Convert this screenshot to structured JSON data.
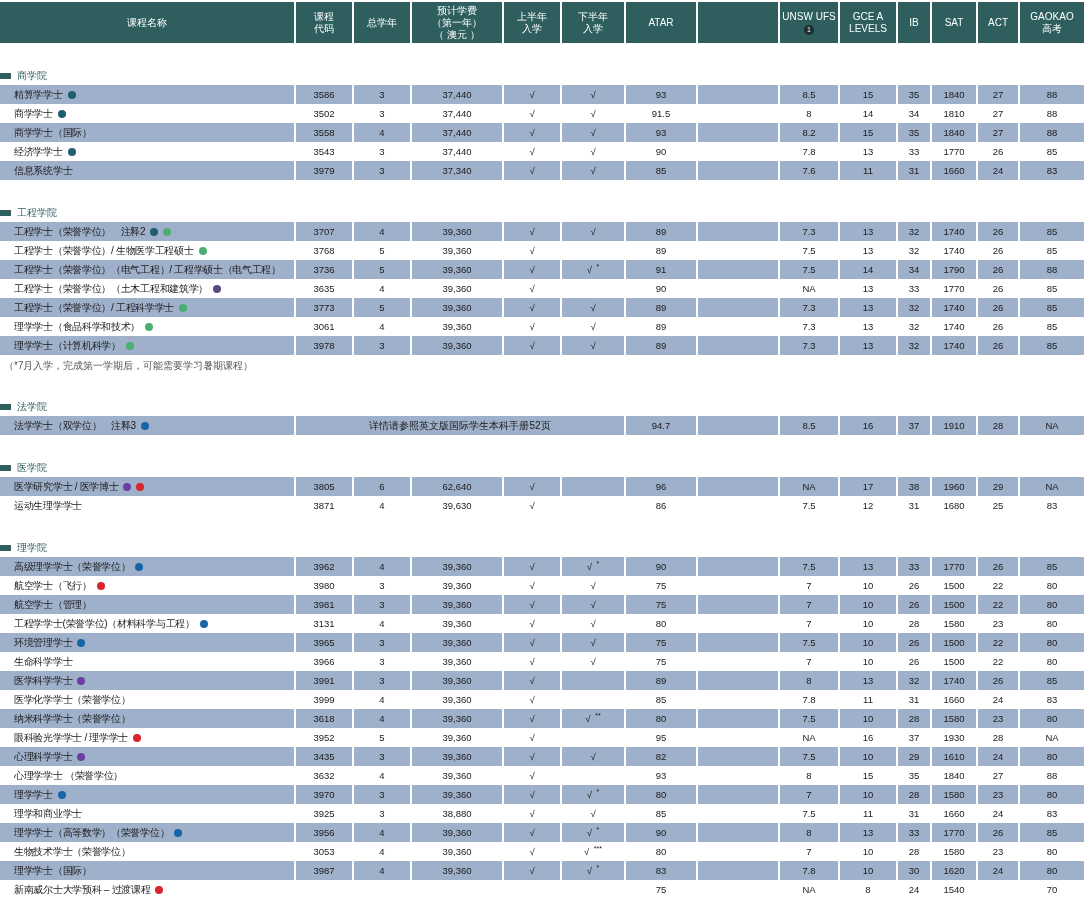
{
  "header": [
    {
      "lines": [
        "课程名称"
      ]
    },
    {
      "lines": [
        "课程",
        "代码"
      ]
    },
    {
      "lines": [
        "总学年"
      ]
    },
    {
      "lines": [
        "预计学费",
        "（第一年）",
        "（ 澳元 ）"
      ]
    },
    {
      "lines": [
        "上半年",
        "入学"
      ]
    },
    {
      "lines": [
        "下半年",
        "入学"
      ]
    },
    {
      "lines": [
        "ATAR"
      ]
    },
    {
      "lines": [
        "UNSW UFS"
      ],
      "badge": "1"
    },
    {
      "lines": [
        "GCE A",
        "LEVELS"
      ]
    },
    {
      "lines": [
        "IB"
      ]
    },
    {
      "lines": [
        "SAT"
      ]
    },
    {
      "lines": [
        "ACT"
      ]
    },
    {
      "lines": [
        "GAOKAO",
        "高考"
      ]
    }
  ],
  "sections": [
    {
      "title": "商学院",
      "rows": [
        {
          "name": "精算学学士",
          "dots": [
            {
              "color": "#1d5f72"
            }
          ],
          "code": "3586",
          "years": "3",
          "fee": "37,440",
          "first_half": "√",
          "second_half": "√",
          "atar": "93",
          "ufs": "8.5",
          "gce": "15",
          "ib": "35",
          "sat": "1840",
          "act": "27",
          "gaokao": "88"
        },
        {
          "name": "商学学士",
          "dots": [
            {
              "color": "#1d5f72"
            }
          ],
          "code": "3502",
          "years": "3",
          "fee": "37,440",
          "first_half": "√",
          "second_half": "√",
          "atar": "91.5",
          "ufs": "8",
          "gce": "14",
          "ib": "34",
          "sat": "1810",
          "act": "27",
          "gaokao": "88"
        },
        {
          "name": "商学学士（国际）",
          "code": "3558",
          "years": "4",
          "fee": "37,440",
          "first_half": "√",
          "second_half": "√",
          "atar": "93",
          "ufs": "8.2",
          "gce": "15",
          "ib": "35",
          "sat": "1840",
          "act": "27",
          "gaokao": "88"
        },
        {
          "name": "经济学学士",
          "dots": [
            {
              "color": "#1d5f72"
            }
          ],
          "code": "3543",
          "years": "3",
          "fee": "37,440",
          "first_half": "√",
          "second_half": "√",
          "atar": "90",
          "ufs": "7.8",
          "gce": "13",
          "ib": "33",
          "sat": "1770",
          "act": "26",
          "gaokao": "85"
        },
        {
          "name": "信息系统学士",
          "code": "3979",
          "years": "3",
          "fee": "37,340",
          "first_half": "√",
          "second_half": "√",
          "atar": "85",
          "ufs": "7.6",
          "gce": "11",
          "ib": "31",
          "sat": "1660",
          "act": "24",
          "gaokao": "83"
        }
      ]
    },
    {
      "title": "工程学院",
      "rows": [
        {
          "name": "工程学士（荣誉学位）　注释2",
          "dots": [
            {
              "color": "#1d5f72"
            },
            {
              "color": "#4caf72"
            }
          ],
          "code": "3707",
          "years": "4",
          "fee": "39,360",
          "first_half": "√",
          "second_half": "√",
          "atar": "89",
          "ufs": "7.3",
          "gce": "13",
          "ib": "32",
          "sat": "1740",
          "act": "26",
          "gaokao": "85"
        },
        {
          "name": "工程学士（荣誉学位）/ 生物医学工程硕士",
          "dots": [
            {
              "color": "#4caf72"
            }
          ],
          "code": "3768",
          "years": "5",
          "fee": "39,360",
          "first_half": "√",
          "atar": "89",
          "ufs": "7.5",
          "gce": "13",
          "ib": "32",
          "sat": "1740",
          "act": "26",
          "gaokao": "85"
        },
        {
          "name": "工程学士（荣誉学位）（电气工程）/ 工程学硕士（电气工程）",
          "code": "3736",
          "years": "5",
          "fee": "39,360",
          "first_half": "√",
          "second_half": "√ $^{*}$",
          "atar": "91",
          "ufs": "7.5",
          "gce": "14",
          "ib": "34",
          "sat": "1790",
          "act": "26",
          "gaokao": "88"
        },
        {
          "name": "工程学士（荣誉学位）（土木工程和建筑学）",
          "dots": [
            {
              "color": "#5a4a7e"
            }
          ],
          "code": "3635",
          "years": "4",
          "fee": "39,360",
          "first_half": "√",
          "atar": "90",
          "ufs": "NA",
          "gce": "13",
          "ib": "33",
          "sat": "1770",
          "act": "26",
          "gaokao": "85"
        },
        {
          "name": "工程学士（荣誉学位）/ 工程科学学士",
          "dots": [
            {
              "color": "#4caf72"
            }
          ],
          "code": "3773",
          "years": "5",
          "fee": "39,360",
          "first_half": "√",
          "second_half": "√",
          "atar": "89",
          "ufs": "7.3",
          "gce": "13",
          "ib": "32",
          "sat": "1740",
          "act": "26",
          "gaokao": "85"
        },
        {
          "name": "理学学士（食品科学和技术）",
          "dots": [
            {
              "color": "#4caf72"
            }
          ],
          "code": "3061",
          "years": "4",
          "fee": "39,360",
          "first_half": "√",
          "second_half": "√",
          "atar": "89",
          "ufs": "7.3",
          "gce": "13",
          "ib": "32",
          "sat": "1740",
          "act": "26",
          "gaokao": "85"
        },
        {
          "name": "理学学士（计算机科学）",
          "dots": [
            {
              "color": "#4caf72"
            }
          ],
          "code": "3978",
          "years": "3",
          "fee": "39,360",
          "first_half": "√",
          "second_half": "√",
          "atar": "89",
          "ufs": "7.3",
          "gce": "13",
          "ib": "32",
          "sat": "1740",
          "act": "26",
          "gaokao": "85"
        }
      ],
      "note": "（*7月入学，完成第一学期后，可能需要学习暑期课程）"
    },
    {
      "title": "法学院",
      "rows": [
        {
          "name": "法学学士（双学位）　注释3",
          "dots": [
            {
              "color": "#1565a8"
            }
          ],
          "span_text": "详情请参照英文版国际学生本科手册52页",
          "atar": "94.7",
          "ufs": "8.5",
          "gce": "16",
          "ib": "37",
          "sat": "1910",
          "act": "28",
          "gaokao": "NA"
        }
      ]
    },
    {
      "title": "医学院",
      "rows": [
        {
          "name": "医学研究学士 / 医学博士",
          "dots": [
            {
              "color": "#6b3fa0"
            },
            {
              "color": "#d9262e"
            }
          ],
          "code": "3805",
          "years": "6",
          "fee": "62,640",
          "first_half": "√",
          "atar": "96",
          "ufs": "NA",
          "gce": "17",
          "ib": "38",
          "sat": "1960",
          "act": "29",
          "gaokao": "NA"
        },
        {
          "name": "运动生理学学士",
          "code": "3871",
          "years": "4",
          "fee": "39,630",
          "first_half": "√",
          "atar": "86",
          "ufs": "7.5",
          "gce": "12",
          "ib": "31",
          "sat": "1680",
          "act": "25",
          "gaokao": "83"
        }
      ]
    },
    {
      "title": "理学院",
      "rows": [
        {
          "name": "高级理学学士（荣誉学位）",
          "dots": [
            {
              "color": "#1565a8"
            }
          ],
          "code": "3962",
          "years": "4",
          "fee": "39,360",
          "first_half": "√",
          "second_half": "√ $^{*}$",
          "atar": "90",
          "ufs": "7.5",
          "gce": "13",
          "ib": "33",
          "sat": "1770",
          "act": "26",
          "gaokao": "85"
        },
        {
          "name": "航空学士（飞行）",
          "dots": [
            {
              "color": "#d9262e"
            }
          ],
          "code": "3980",
          "years": "3",
          "fee": "39,360",
          "first_half": "√",
          "second_half": "√",
          "atar": "75",
          "ufs": "7",
          "gce": "10",
          "ib": "26",
          "sat": "1500",
          "act": "22",
          "gaokao": "80"
        },
        {
          "name": "航空学士（管理）",
          "code": "3981",
          "years": "3",
          "fee": "39,360",
          "first_half": "√",
          "second_half": "√",
          "atar": "75",
          "ufs": "7",
          "gce": "10",
          "ib": "26",
          "sat": "1500",
          "act": "22",
          "gaokao": "80"
        },
        {
          "name": "工程学学士(荣誉学位)（材料科学与工程）",
          "dots": [
            {
              "color": "#1565a8"
            }
          ],
          "code": "3131",
          "years": "4",
          "fee": "39,360",
          "first_half": "√",
          "second_half": "√",
          "atar": "80",
          "ufs": "7",
          "gce": "10",
          "ib": "28",
          "sat": "1580",
          "act": "23",
          "gaokao": "80"
        },
        {
          "name": "环境管理学士",
          "dots": [
            {
              "color": "#1565a8"
            }
          ],
          "code": "3965",
          "years": "3",
          "fee": "39,360",
          "first_half": "√",
          "second_half": "√",
          "atar": "75",
          "ufs": "7.5",
          "gce": "10",
          "ib": "26",
          "sat": "1500",
          "act": "22",
          "gaokao": "80"
        },
        {
          "name": "生命科学学士",
          "code": "3966",
          "years": "3",
          "fee": "39,360",
          "first_half": "√",
          "second_half": "√",
          "atar": "75",
          "ufs": "7",
          "gce": "10",
          "ib": "26",
          "sat": "1500",
          "act": "22",
          "gaokao": "80"
        },
        {
          "name": "医学科学学士",
          "dots": [
            {
              "color": "#6b3fa0"
            }
          ],
          "code": "3991",
          "years": "3",
          "fee": "39,360",
          "first_half": "√",
          "atar": "89",
          "ufs": "8",
          "gce": "13",
          "ib": "32",
          "sat": "1740",
          "act": "26",
          "gaokao": "85"
        },
        {
          "name": "医学化学学士（荣誉学位）",
          "code": "3999",
          "years": "4",
          "fee": "39,360",
          "first_half": "√",
          "atar": "85",
          "ufs": "7.8",
          "gce": "11",
          "ib": "31",
          "sat": "1660",
          "act": "24",
          "gaokao": "83"
        },
        {
          "name": "纳米科学学士（荣誉学位）",
          "code": "3618",
          "years": "4",
          "fee": "39,360",
          "first_half": "√",
          "second_half": "√ $^{**}$",
          "atar": "80",
          "ufs": "7.5",
          "gce": "10",
          "ib": "28",
          "sat": "1580",
          "act": "23",
          "gaokao": "80"
        },
        {
          "name": "眼科验光学学士 / 理学学士",
          "dots": [
            {
              "color": "#d9262e"
            }
          ],
          "code": "3952",
          "years": "5",
          "fee": "39,360",
          "first_half": "√",
          "atar": "95",
          "ufs": "NA",
          "gce": "16",
          "ib": "37",
          "sat": "1930",
          "act": "28",
          "gaokao": "NA"
        },
        {
          "name": "心理科学学士",
          "dots": [
            {
              "color": "#6b3fa0"
            }
          ],
          "code": "3435",
          "years": "3",
          "fee": "39,360",
          "first_half": "√",
          "second_half": "√",
          "atar": "82",
          "ufs": "7.5",
          "gce": "10",
          "ib": "29",
          "sat": "1610",
          "act": "24",
          "gaokao": "80"
        },
        {
          "name": "心理学学士 （荣誉学位）",
          "code": "3632",
          "years": "4",
          "fee": "39,360",
          "first_half": "√",
          "atar": "93",
          "ufs": "8",
          "gce": "15",
          "ib": "35",
          "sat": "1840",
          "act": "27",
          "gaokao": "88"
        },
        {
          "name": "理学学士",
          "dots": [
            {
              "color": "#1565a8"
            }
          ],
          "code": "3970",
          "years": "3",
          "fee": "39,360",
          "first_half": "√",
          "second_half": "√ $^{*}$",
          "atar": "80",
          "ufs": "7",
          "gce": "10",
          "ib": "28",
          "sat": "1580",
          "act": "23",
          "gaokao": "80"
        },
        {
          "name": "理学和商业学士",
          "code": "3925",
          "years": "3",
          "fee": "38,880",
          "first_half": "√",
          "second_half": "√",
          "atar": "85",
          "ufs": "7.5",
          "gce": "11",
          "ib": "31",
          "sat": "1660",
          "act": "24",
          "gaokao": "83"
        },
        {
          "name": "理学学士（高等数学）（荣誉学位）",
          "dots": [
            {
              "color": "#1565a8"
            }
          ],
          "code": "3956",
          "years": "4",
          "fee": "39,360",
          "first_half": "√",
          "second_half": "√ $^{*}$",
          "atar": "90",
          "ufs": "8",
          "gce": "13",
          "ib": "33",
          "sat": "1770",
          "act": "26",
          "gaokao": "85"
        },
        {
          "name": "生物技术学士（荣誉学位）",
          "code": "3053",
          "years": "4",
          "fee": "39,360",
          "first_half": "√",
          "second_half": "√ $^{***}$",
          "atar": "80",
          "ufs": "7",
          "gce": "10",
          "ib": "28",
          "sat": "1580",
          "act": "23",
          "gaokao": "80"
        },
        {
          "name": "理学学士（国际）",
          "code": "3987",
          "years": "4",
          "fee": "39,360",
          "first_half": "√",
          "second_half": "√ $^{*}$",
          "atar": "83",
          "ufs": "7.8",
          "gce": "10",
          "ib": "30",
          "sat": "1620",
          "act": "24",
          "gaokao": "80"
        },
        {
          "name": "新南威尔士大学预科 – 过渡课程",
          "dots": [
            {
              "color": "#d9262e"
            }
          ],
          "atar": "75",
          "ufs": "NA",
          "gce": "8",
          "ib": "24",
          "sat": "1540",
          "gaokao": "70"
        }
      ]
    }
  ]
}
